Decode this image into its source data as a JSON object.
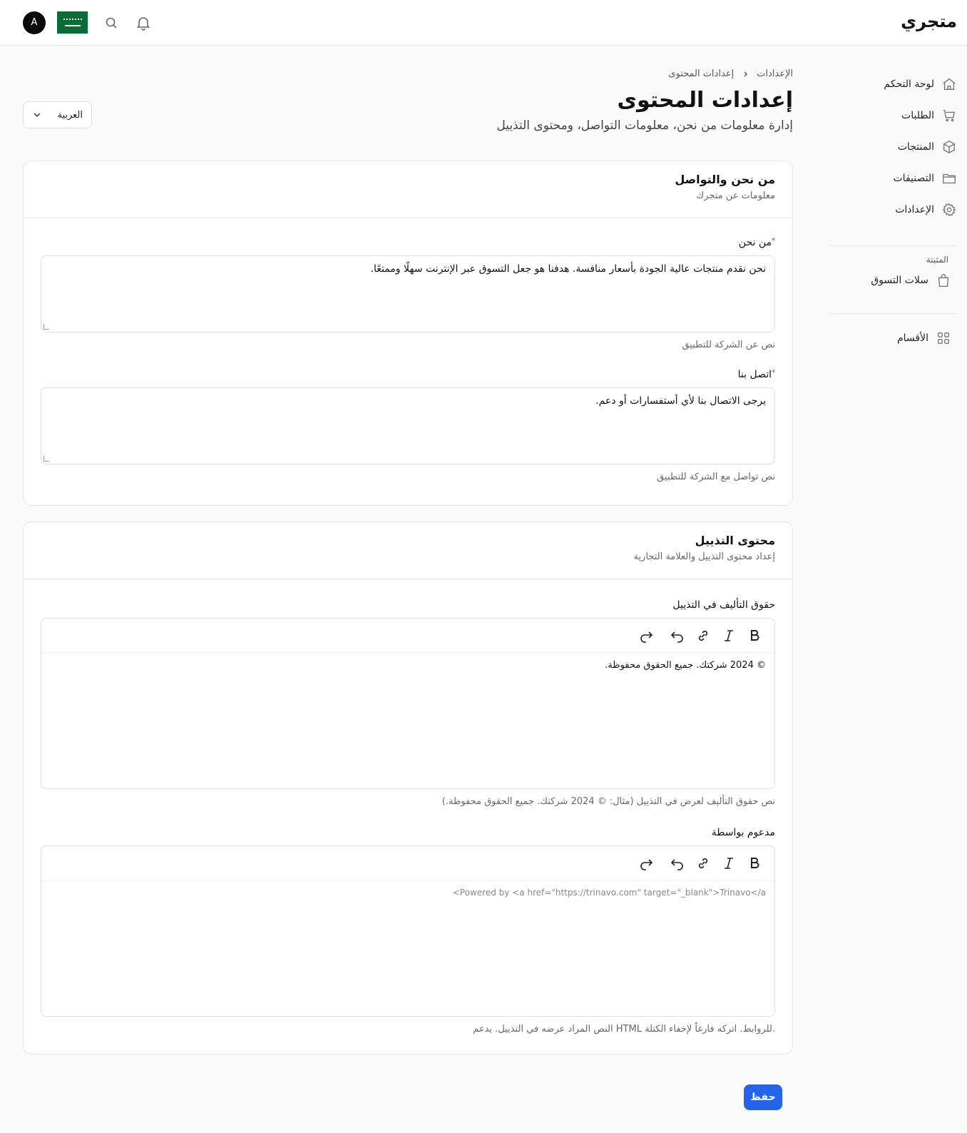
{
  "header": {
    "brand": "متجري",
    "avatar_letter": "A"
  },
  "sidebar": {
    "items": [
      {
        "label": "لوحة التحكم",
        "icon": "home-icon"
      },
      {
        "label": "الطلبات",
        "icon": "cart-icon"
      },
      {
        "label": "المنتجات",
        "icon": "box-icon"
      },
      {
        "label": "التصنيفات",
        "icon": "folder-icon"
      },
      {
        "label": "الإعدادات",
        "icon": "gear-icon"
      }
    ],
    "section_title": "المثبتة",
    "pinned": [
      {
        "label": "سلات التسوق",
        "icon": "bag-icon"
      }
    ],
    "bottom": [
      {
        "label": "الأقسام",
        "icon": "grid-icon"
      }
    ]
  },
  "breadcrumb": {
    "root": "الإعدادات",
    "current": "إعدادات المحتوى"
  },
  "page": {
    "title": "إعدادات المحتوى",
    "subtitle": "إدارة معلومات من نحن، معلومات التواصل، ومحتوى التذييل",
    "language": "العربية"
  },
  "about_card": {
    "title": "من نحن والتواصل",
    "desc": "معلومات عن متجرك",
    "about_label": "من نحن",
    "about_value": "نحن نقدم منتجات عالية الجودة بأسعار منافسة. هدفنا هو جعل التسوق عبر الإنترنت سهلًا وممتعًا.",
    "about_hint": "نص عن الشركة للتطبيق",
    "contact_label": "اتصل بنا",
    "contact_value": "يرجى الاتصال بنا لأي أستفسارات أو دعم.",
    "contact_hint": "نص تواصل مع الشركة للتطبيق"
  },
  "footer_card": {
    "title": "محتوى التذييل",
    "desc": "إعداد محتوى التذييل والعلامة التجارية",
    "copyright_label": "حقوق التأليف في التذييل",
    "copyright_value": "© 2024 شركتك. جميع الحقوق محفوظة.",
    "copyright_hint": "نص حقوق التأليف لعرض في التذييل (مثال: © 2024 شركتك. جميع الحقوق محفوظة.)",
    "powered_label": "مدعوم بواسطة",
    "powered_placeholder": "<Powered by <a href=\"https://trinavo.com\" target=\"_blank\">Trinavo</a",
    "powered_hint": "النص المراد عرضه في التذييل. يدعم HTML للروابط. اتركه فارغاً لإخفاء الكتلة."
  },
  "actions": {
    "save": "حفظ"
  }
}
